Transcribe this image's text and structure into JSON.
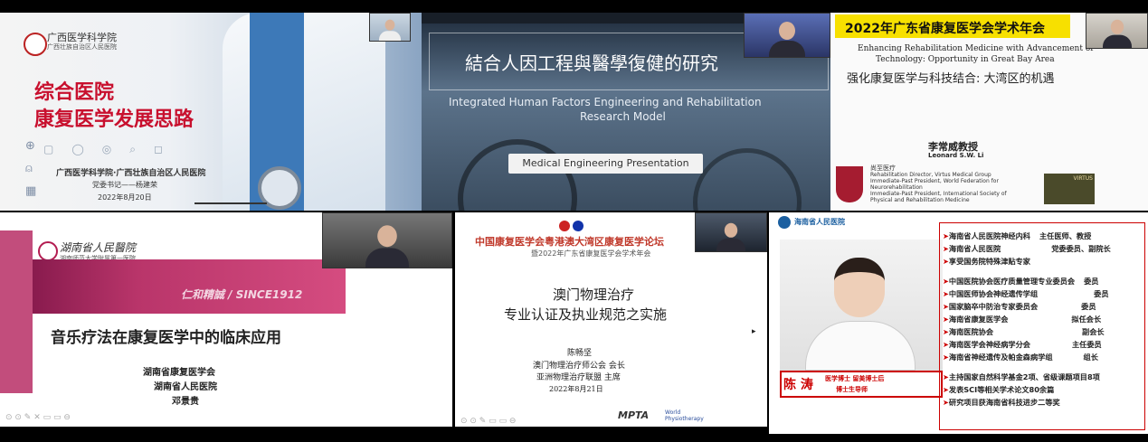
{
  "p1": {
    "logo_text": "广西医学科学院",
    "logo_sub": "广西壮族自治区人民医院",
    "title1": "综合医院",
    "title2": "康复医学发展思路",
    "inst": "广西医学科学院·广西壮族自治区人民医院",
    "speaker": "党委书记——杨建荣",
    "date": "2022年8月20日"
  },
  "p2": {
    "title_cn": "結合人因工程與醫學復健的研究",
    "title_en1": "Integrated Human Factors Engineering and Rehabilitation",
    "title_en2": "Research Model",
    "button": "Medical Engineering Presentation"
  },
  "p3": {
    "banner": "2022年广东省康复医学会学术年会",
    "en1": "Enhancing Rehabilitation Medicine with Advancement of",
    "en2": "Technology: Opportunity in Great Bay Area",
    "cn": "强化康复医学与科技结合: 大湾区的机遇",
    "name_cn": "李常威教授",
    "name_en": "Leonard S.W. Li",
    "org": "尚至医疗",
    "r1": "Rehabilitation Director, Virtus Medical Group",
    "r2": "Immediate-Past President, World Federation for",
    "r3": "Neurorehabilitation",
    "r4": "Immediate-Past President, International Society of",
    "r5": "Physical and Rehabilitation Medicine",
    "virtus": "VIRTUS"
  },
  "p4": {
    "hospital": "湖南省人民醫院",
    "hospital_sub": "湖南师范大学附属第一医院",
    "motto": "仁和精誠 / SINCE1912",
    "title": "音乐疗法在康复医学中的临床应用",
    "l1": "湖南省康复医学会",
    "l2": "湖南省人民医院",
    "l3": "邓景贵"
  },
  "p5": {
    "forum": "中国康复医学会粤港澳大湾区康复医学论坛",
    "sub": "暨2022年广东省康复医学会学术年会",
    "t1": "澳门物理治疗",
    "t2": "专业认证及执业规范之实施",
    "name": "陈畅坚",
    "role1": "澳门物理治疗师公会 会长",
    "role2": "亚洲物理治疗联盟 主席",
    "date": "2022年8月21日",
    "logo1": "MPTA",
    "logo2": "World Physiotherapy"
  },
  "p6": {
    "hospital": "海南省人民医院",
    "name": "陈 涛",
    "deg1": "医学博士  留美博士后",
    "deg2": "博士生导师",
    "items": [
      [
        "海南省人民医院神经内科",
        "主任医师、教授"
      ],
      [
        "海南省人民医院",
        "党委委员、副院长"
      ],
      [
        "享受国务院特殊津贴专家",
        ""
      ],
      [
        "中国医院协会医疗质量管理专业委员会",
        "委员"
      ],
      [
        "中国医师协会神经遗传学组",
        "委员"
      ],
      [
        "国家脑卒中防治专家委员会",
        "委员"
      ],
      [
        "海南省康复医学会",
        "拟任会长"
      ],
      [
        "海南医院协会",
        "副会长"
      ],
      [
        "海南医学会神经病学分会",
        "主任委员"
      ],
      [
        "海南省神经遗传及帕金森病学组",
        "组长"
      ],
      [
        "主持国家自然科学基金2项、省级课题项目8项",
        ""
      ],
      [
        "发表SCI等相关学术论文80余篇",
        ""
      ],
      [
        "研究项目获海南省科技进步二等奖",
        ""
      ]
    ]
  }
}
